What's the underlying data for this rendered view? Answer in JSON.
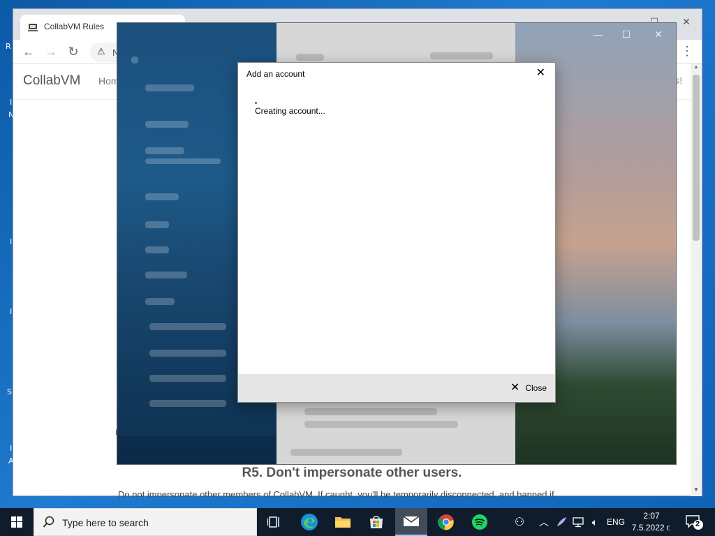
{
  "browser": {
    "tab_title": "CollabVM Rules",
    "omnibox_text": "N",
    "site_brand": "CollabVM",
    "site_nav_home": "Hom",
    "site_header_tail": "s!",
    "side_letter": "D",
    "rule_title": "R5. Don't impersonate other users.",
    "rule_text": "Do not impersonate other members of CollabVM. If caught, you'll be temporarily disconnected, and banned if"
  },
  "desktop": {
    "left_letters": [
      "R",
      "I",
      "N",
      "I",
      "I",
      "S",
      "I",
      "A"
    ]
  },
  "dialog": {
    "title": "Add an account",
    "status": "Creating account...",
    "close_label": "Close"
  },
  "taskbar": {
    "search_placeholder": "Type here to search",
    "language": "ENG",
    "time": "2:07",
    "date": "7.5.2022 г.",
    "notification_count": "2"
  },
  "colors": {
    "accent": "#0078d7",
    "taskbar": "#0f1c2c",
    "desktop": "#1f7ad0"
  }
}
